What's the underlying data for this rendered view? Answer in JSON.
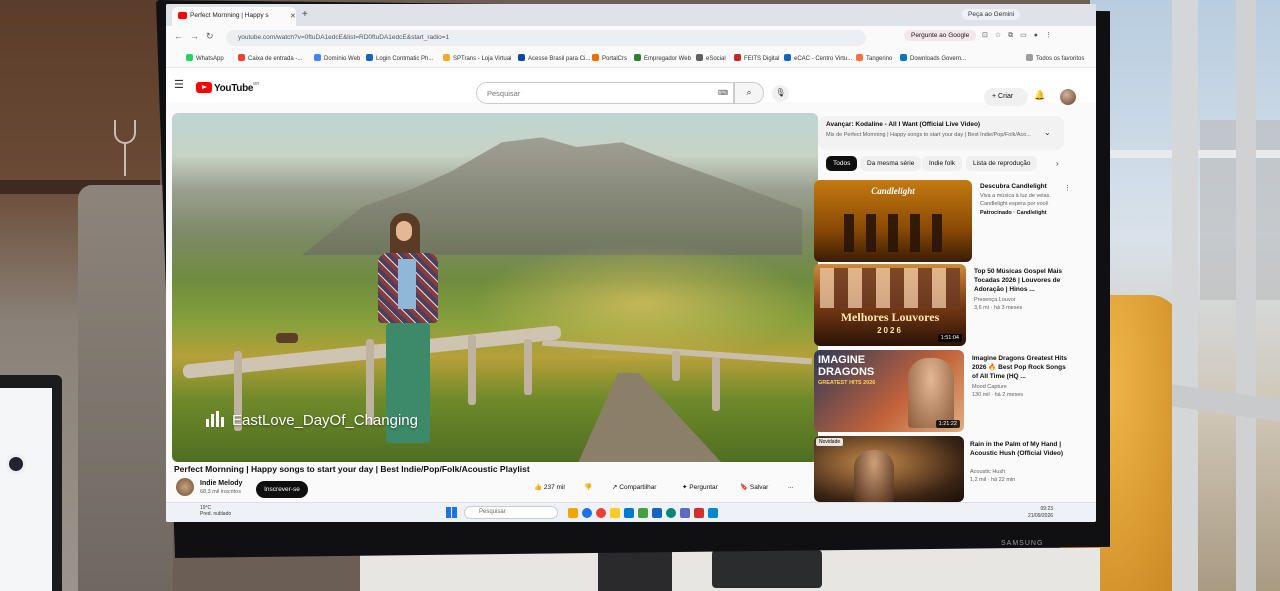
{
  "browser": {
    "tab_title": "Perfect Mornning | Happy s",
    "url": "youtube.com/watch?v=0ftuDA1edcE&list=RD0ftuDA1edcE&start_radio=1",
    "gemini_label": "Peça ao Gemini",
    "ask_google_label": "Pergunte ao Google",
    "bookmarks": [
      {
        "label": "WhatsApp",
        "color": "#25d366"
      },
      {
        "label": "Caixa de entrada -...",
        "color": "#ea4335"
      },
      {
        "label": "Domínio Web",
        "color": "#4285f4"
      },
      {
        "label": "Login Contmatic Ph...",
        "color": "#1565c0"
      },
      {
        "label": "SPTrans - Loja Virtual",
        "color": "#f9a825"
      },
      {
        "label": "Acesse Brasil para Ci...",
        "color": "#0d47a1"
      },
      {
        "label": "PortalCrs",
        "color": "#ef6c00"
      },
      {
        "label": "Empregador Web",
        "color": "#2e7d32"
      },
      {
        "label": "eSocial",
        "color": "#616161"
      },
      {
        "label": "FEITS Digital",
        "color": "#c62828"
      },
      {
        "label": "eCAC - Centro Virtu...",
        "color": "#1565c0"
      },
      {
        "label": "Tangerino",
        "color": "#ff7043"
      },
      {
        "label": "Downloads Govern...",
        "color": "#0277bd"
      }
    ],
    "all_favorites": "Todos os favoritos"
  },
  "youtube": {
    "logo_text": "YouTube",
    "logo_region": "BR",
    "search_placeholder": "Pesquisar",
    "create_label": "Criar"
  },
  "player": {
    "watermark": "EastLove_DayOf_Changing"
  },
  "video": {
    "title": "Perfect Mornning | Happy songs to start your day | Best Indie/Pop/Folk/Acoustic Playlist",
    "channel": "Indie Melody",
    "subscribers": "68,3 mil inscritos",
    "subscribe_label": "Inscrever-se",
    "likes": "237 mil",
    "share_label": "Compartilhar",
    "ask_label": "Perguntar",
    "save_label": "Salvar",
    "more_label": "..."
  },
  "up_next": {
    "title": "Avançar: Kodaline - All I Want (Official Live Video)",
    "subtitle": "Mix de Perfect Mornning | Happy songs to start your day | Best Indie/Pop/Folk/Aco..."
  },
  "chips": [
    "Todos",
    "Da mesma série",
    "Indie folk",
    "Lista de reprodução"
  ],
  "recommendations": [
    {
      "thumb_text": "Candlelight",
      "title": "Descubra Candlelight",
      "meta1": "Viva a música à luz de velas.",
      "meta2": "Candlelight espera por você",
      "meta3": "Patrocinado · Candlelight",
      "duration": ""
    },
    {
      "thumb_text": "Melhores Louvores",
      "thumb_sub": "2026",
      "title": "Top 50 Músicas Gospel Mais Tocadas 2026 | Louvores de Adoração | Hinos ...",
      "meta1": "Presença Louvor",
      "meta2": "3,6 mi · há 3 meses",
      "duration": "1:51:04"
    },
    {
      "thumb_text": "IMAGINE DRAGONS",
      "thumb_sub": "GREATEST HITS 2026",
      "title": "Imagine Dragons Greatest Hits 2026 🔥 Best Pop Rock Songs of All Time (HQ ...",
      "meta1": "Mood Capture",
      "meta2": "130 mil · há 2 meses",
      "duration": "1:21:22"
    },
    {
      "thumb_text": "",
      "badge": "Novidade",
      "title": "Rain in the Palm of My Hand | Acoustic Hush (Official Video)",
      "meta1": "Acoustic Hush",
      "meta2": "1,2 mil · há 22 min",
      "duration": ""
    }
  ],
  "taskbar": {
    "weather_temp": "19°C",
    "weather_desc": "Pred. nublado",
    "search_placeholder": "Pesquisar",
    "time": "09:23",
    "date": "21/09/2026"
  },
  "monitor_brand": "SAMSUNG"
}
